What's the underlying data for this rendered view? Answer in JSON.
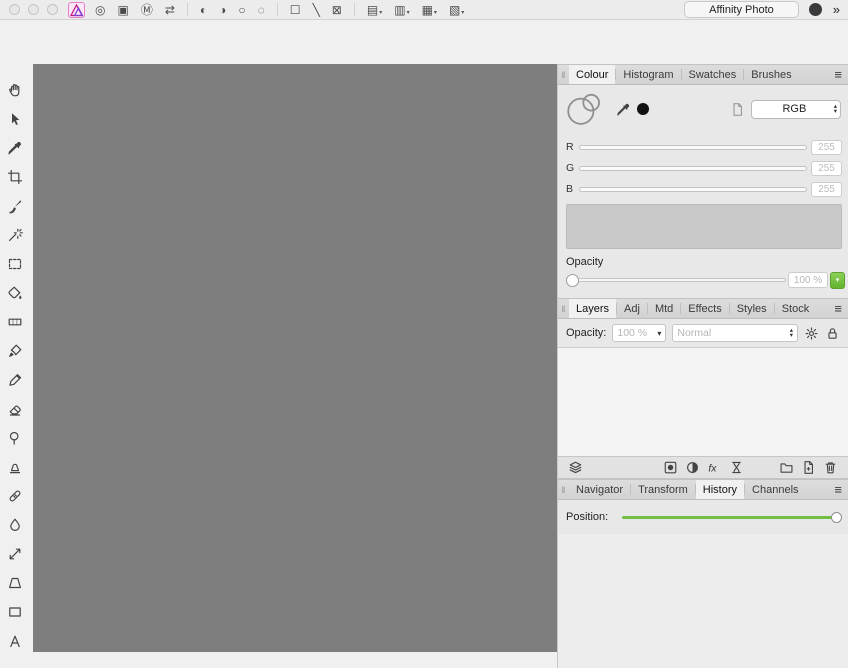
{
  "window": {
    "title": "Affinity Photo",
    "overflow_chevron": "»"
  },
  "glyphs": {
    "panel_menu": "≡",
    "panel_grip": "‖",
    "dropdown_arrow": "▾",
    "stepper_up": "▴",
    "stepper_down": "▾"
  },
  "toolbar": {
    "items": [
      {
        "name": "target",
        "glyph": "◎"
      },
      {
        "name": "assets",
        "glyph": "▣"
      },
      {
        "name": "macro",
        "glyph": "Ⓜ"
      },
      {
        "name": "swap-arrows",
        "glyph": "⇄"
      },
      {
        "type": "sep"
      },
      {
        "name": "auto-levels",
        "glyph": "◐"
      },
      {
        "name": "auto-contrast",
        "glyph": "◑"
      },
      {
        "name": "auto-colour",
        "glyph": "○"
      },
      {
        "name": "auto-white-balance",
        "glyph": "◌"
      },
      {
        "type": "sep"
      },
      {
        "name": "selection-box",
        "glyph": "☐"
      },
      {
        "name": "snapping",
        "glyph": "╲"
      },
      {
        "name": "clip-canvas",
        "glyph": "⊠"
      },
      {
        "type": "sep"
      },
      {
        "name": "workspace-1",
        "glyph": "▤",
        "dropdown": true
      },
      {
        "name": "workspace-2",
        "glyph": "▥",
        "dropdown": true
      },
      {
        "name": "workspace-3",
        "glyph": "▦",
        "dropdown": true
      },
      {
        "name": "workspace-4",
        "glyph": "▧",
        "dropdown": true
      }
    ]
  },
  "tools": [
    "view-tool",
    "move-tool",
    "colour-picker-tool",
    "crop-tool",
    "selection-brush-tool",
    "flood-select-tool",
    "marquee-tool",
    "flood-fill-tool",
    "gradient-tool",
    "paint-brush-tool",
    "pixel-tool",
    "eraser-tool",
    "dodge-tool",
    "clone-stamp-tool",
    "healing-brush-tool",
    "blur-tool",
    "mesh-warp-tool",
    "perspective-tool",
    "shape-tool",
    "text-tool"
  ],
  "colour_panel": {
    "tabs": [
      "Colour",
      "Histogram",
      "Swatches",
      "Brushes"
    ],
    "active_tab": "Colour",
    "colour_mode": "RGB",
    "sliders": [
      {
        "label": "R",
        "value": "255"
      },
      {
        "label": "G",
        "value": "255"
      },
      {
        "label": "B",
        "value": "255"
      }
    ],
    "opacity_label": "Opacity",
    "opacity_value": "100 %"
  },
  "layers_panel": {
    "tabs": [
      "Layers",
      "Adj",
      "Mtd",
      "Effects",
      "Styles",
      "Stock"
    ],
    "active_tab": "Layers",
    "opacity_label": "Opacity:",
    "opacity_value": "100 %",
    "blend_mode": "Normal"
  },
  "navigator_panel": {
    "tabs": [
      "Navigator",
      "Transform",
      "History",
      "Channels"
    ],
    "active_tab": "History",
    "position_label": "Position:"
  },
  "colors": {
    "accent_green": "#74c044",
    "canvas_gray": "#7e7e7e"
  }
}
